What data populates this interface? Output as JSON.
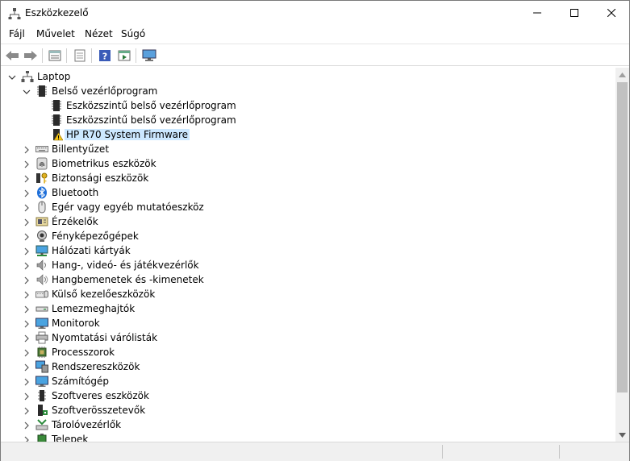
{
  "window": {
    "title": "Eszközkezelő",
    "controls": [
      "minimize",
      "maximize",
      "close"
    ]
  },
  "menu": [
    "Fájl",
    "Művelet",
    "Nézet",
    "Súgó"
  ],
  "toolbar": {
    "buttons": [
      "back-icon",
      "forward-icon",
      "properties-icon",
      "show-hidden-icon",
      "help-icon",
      "run-icon",
      "monitor-scan-icon"
    ]
  },
  "tree": {
    "root": "Laptop",
    "firmware": {
      "label": "Belső vezérlőprogram",
      "children": [
        "Eszközszintű belső vezérlőprogram",
        "Eszközszintű belső vezérlőprogram",
        "HP R70 System Firmware"
      ]
    },
    "categories": [
      "Billentyűzet",
      "Biometrikus eszközök",
      "Biztonsági eszközök",
      "Bluetooth",
      "Egér vagy egyéb mutatóeszköz",
      "Érzékelők",
      "Fényképezőgépek",
      "Hálózati kártyák",
      "Hang-, videó- és játékvezérlők",
      "Hangbemenetek és -kimenetek",
      "Külső kezelőeszközök",
      "Lemezmeghajtók",
      "Monitorok",
      "Nyomtatási várólisták",
      "Processzorok",
      "Rendszereszközök",
      "Számítógép",
      "Szoftveres eszközök",
      "Szoftverösszetevők",
      "Tárolóvezérlők",
      "Telepek"
    ],
    "category_icons": [
      "keyboard-icon",
      "fingerprint-icon",
      "security-key-icon",
      "bluetooth-icon",
      "mouse-icon",
      "sensor-icon",
      "camera-icon",
      "network-icon",
      "speaker-icon",
      "audio-io-icon",
      "hid-icon",
      "disk-drive-icon",
      "monitor-icon",
      "printer-queue-icon",
      "processor-icon",
      "system-device-icon",
      "computer-icon",
      "software-device-icon",
      "software-component-icon",
      "storage-controller-icon",
      "battery-icon"
    ]
  },
  "colors": {
    "selection": "#cce8ff",
    "warning": "#f5c518",
    "bluetooth": "#1e6fd9"
  }
}
